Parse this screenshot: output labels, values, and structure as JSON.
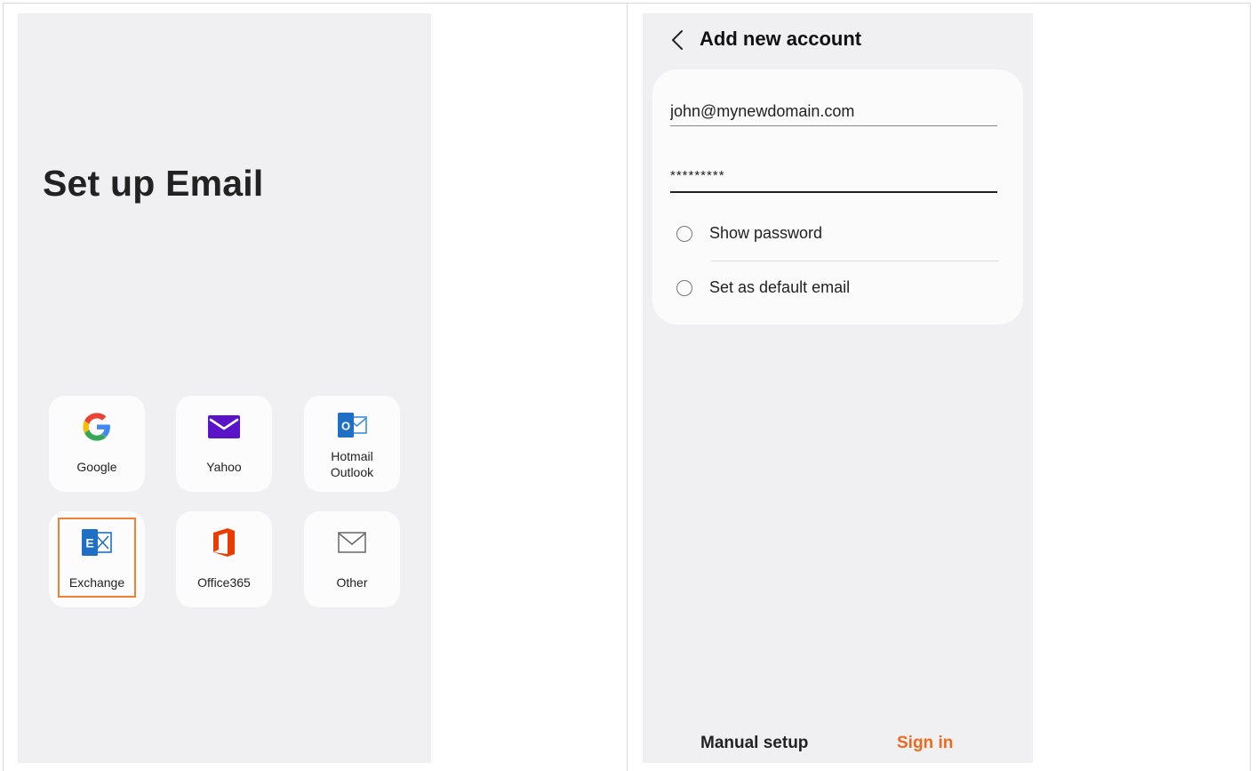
{
  "left_screen": {
    "title": "Set up Email",
    "providers": [
      {
        "label": "Google",
        "icon": "google-icon"
      },
      {
        "label": "Yahoo",
        "icon": "yahoo-icon"
      },
      {
        "label_line1": "Hotmail",
        "label_line2": "Outlook",
        "icon": "outlook-icon"
      },
      {
        "label": "Exchange",
        "icon": "exchange-icon",
        "selected": true
      },
      {
        "label": "Office365",
        "icon": "office365-icon"
      },
      {
        "label": "Other",
        "icon": "envelope-icon"
      }
    ]
  },
  "right_screen": {
    "title": "Add new account",
    "email_value": "john@mynewdomain.com",
    "password_value": "*********",
    "show_password_label": "Show password",
    "default_email_label": "Set as default email",
    "manual_setup_label": "Manual setup",
    "sign_in_label": "Sign in"
  },
  "colors": {
    "accent": "#ec6a1e",
    "selection_border": "#f08033",
    "screen_bg": "#f0f0f2"
  }
}
